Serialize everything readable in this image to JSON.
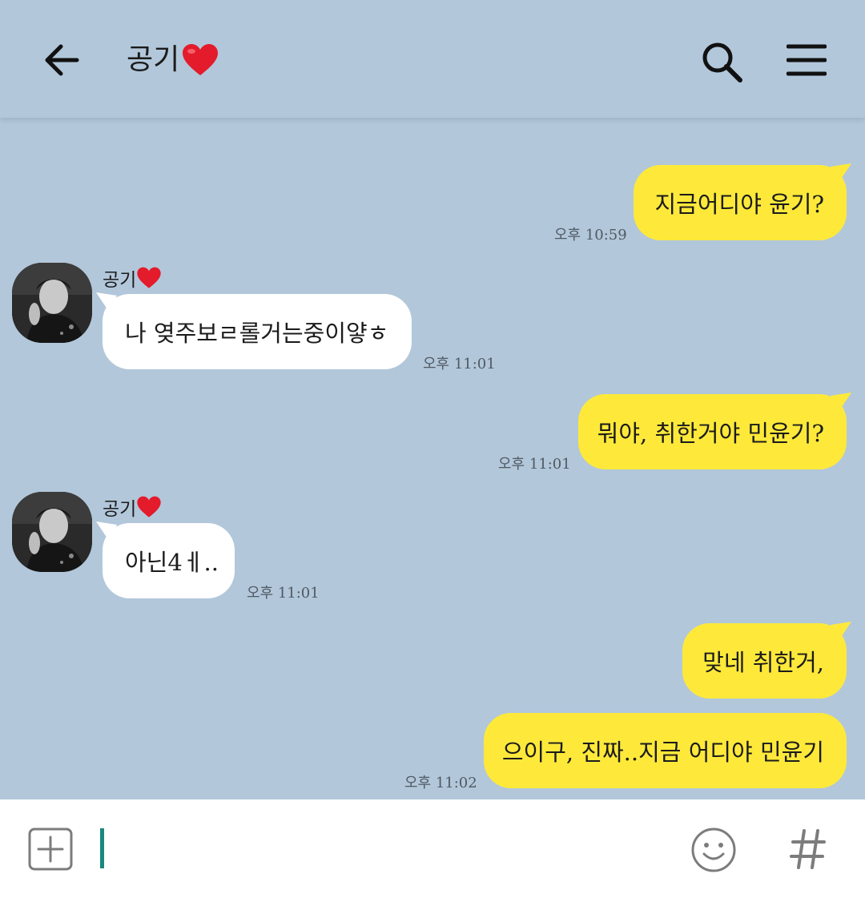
{
  "header": {
    "title": "공기",
    "title_emoji": "heart-icon",
    "back_icon": "back-arrow-icon",
    "search_icon": "search-icon",
    "menu_icon": "menu-icon"
  },
  "messages": [
    {
      "from": "me",
      "text": "지금어디야 윤기?",
      "time": "오후 10:59"
    },
    {
      "from": "other",
      "sender": "공기",
      "text": "나 옂주보ㄹ롤거는중이얗ㅎ",
      "time": "오후 11:01"
    },
    {
      "from": "me",
      "text": "뭐야, 취한거야 민윤기?",
      "time": "오후 11:01"
    },
    {
      "from": "other",
      "sender": "공기",
      "text": "아닌4ㅔ..",
      "time": "오후 11:01"
    },
    {
      "from": "me",
      "text": "맞네 취한거,",
      "time": ""
    },
    {
      "from": "me",
      "text": "으이구, 진짜..지금 어디야 민윤기",
      "time": "오후 11:02"
    }
  ],
  "input": {
    "value": "",
    "plus_icon": "plus-box-icon",
    "emoji_icon": "emoji-icon",
    "hash_icon": "hashtag-icon"
  },
  "colors": {
    "background": "#b2c7da",
    "my_bubble": "#fee93a",
    "other_bubble": "#ffffff",
    "cursor": "#17897d"
  }
}
